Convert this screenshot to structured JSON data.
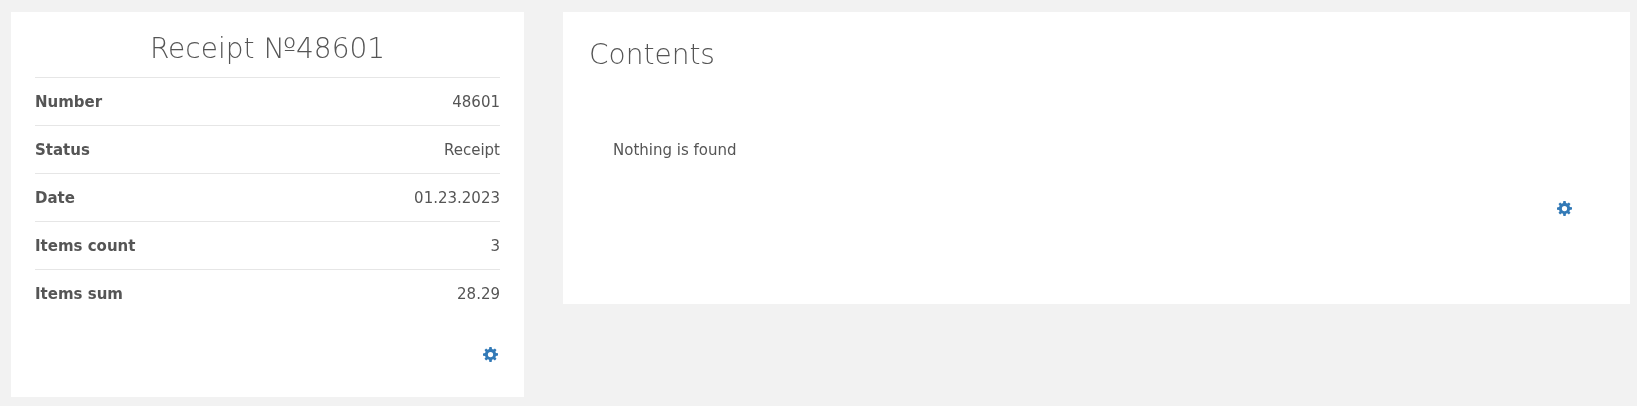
{
  "receipt": {
    "title": "Receipt №48601",
    "rows": [
      {
        "label": "Number",
        "value": "48601"
      },
      {
        "label": "Status",
        "value": "Receipt"
      },
      {
        "label": "Date",
        "value": "01.23.2023"
      },
      {
        "label": "Items count",
        "value": "3"
      },
      {
        "label": "Items sum",
        "value": "28.29"
      }
    ]
  },
  "contents": {
    "title": "Contents",
    "empty_message": "Nothing is found"
  }
}
